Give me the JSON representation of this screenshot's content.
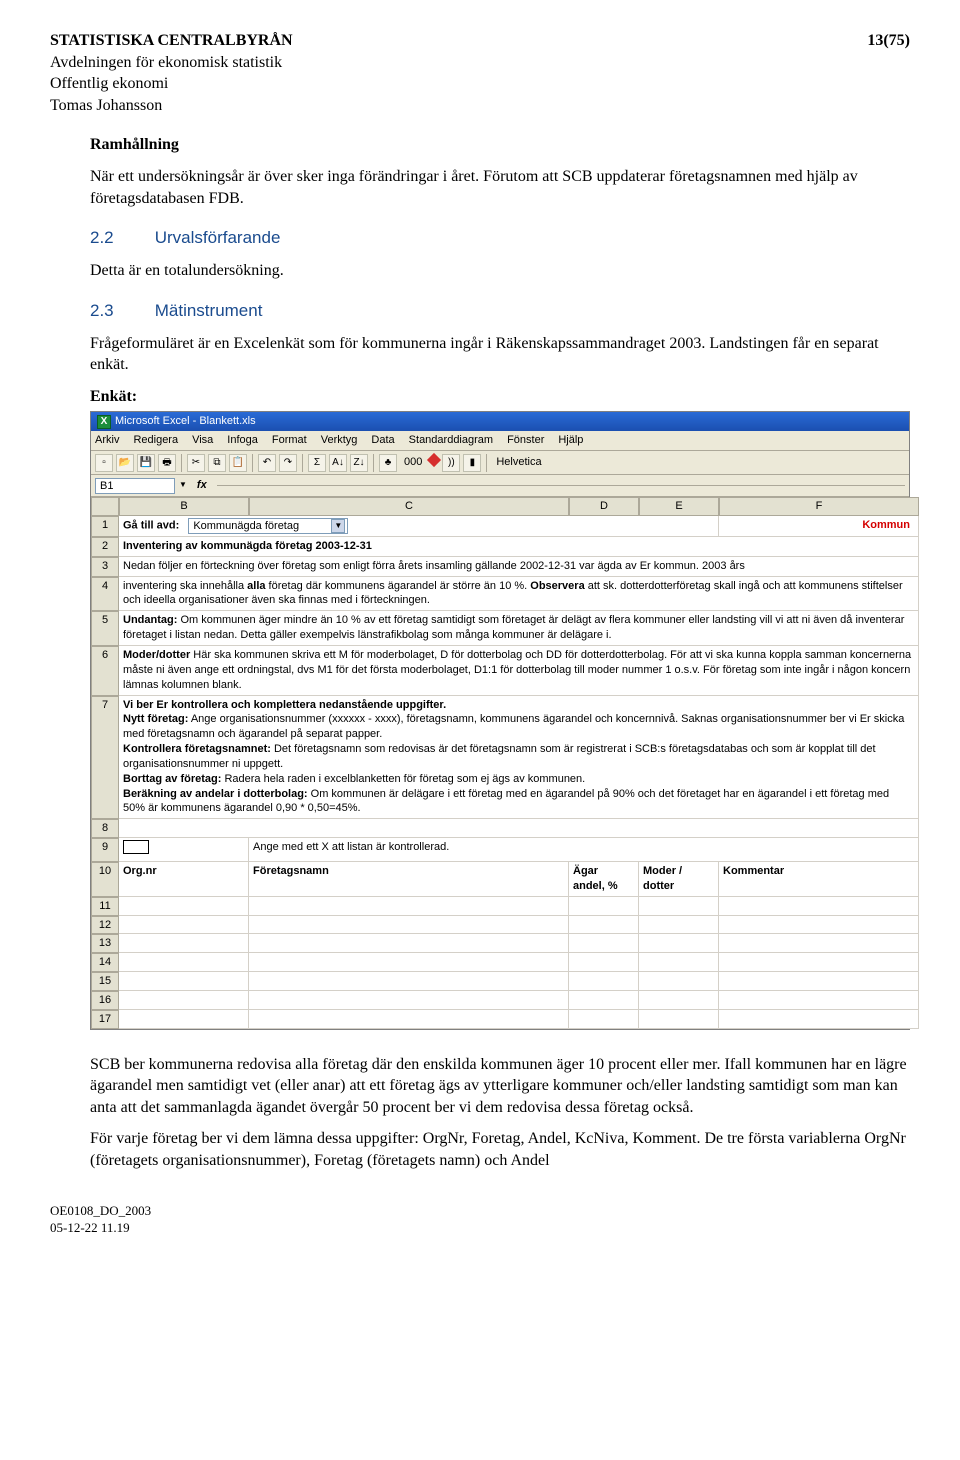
{
  "header": {
    "org": "STATISTISKA CENTRALBYRÅN",
    "page": "13(75)",
    "line2": "Avdelningen för ekonomisk statistik",
    "line3": "Offentlig ekonomi",
    "line4": "Tomas Johansson"
  },
  "body": {
    "ramhallning_title": "Ramhållning",
    "ramhallning_text": "När ett undersökningsår är över sker inga förändringar i året. Förutom att SCB uppdaterar företagsnamnen med hjälp av företagsdatabasen FDB.",
    "s22_num": "2.2",
    "s22_title": "Urvalsförfarande",
    "s22_text": "Detta är en totalundersökning.",
    "s23_num": "2.3",
    "s23_title": "Mätinstrument",
    "s23_text": "Frågeformuläret är en Excelenkät som för kommunerna ingår i Räkenskapssammandraget 2003. Landstingen får en separat enkät.",
    "s23_enkat": "Enkät:",
    "post_excel_p1": "SCB ber kommunerna redovisa alla företag där den enskilda kommunen äger 10 procent eller mer. Ifall kommunen har en lägre ägarandel men samtidigt vet (eller anar) att ett företag ägs av ytterligare kommuner och/eller landsting samtidigt som man kan anta att det sammanlagda ägandet övergår 50 procent ber vi dem redovisa dessa företag också.",
    "post_excel_p2": "För varje företag ber vi dem lämna dessa uppgifter: OrgNr, Foretag, Andel, KcNiva, Komment. De tre första variablerna OrgNr (företagets organisationsnummer), Foretag (företagets namn) och Andel"
  },
  "excel": {
    "title": "Microsoft Excel - Blankett.xls",
    "menu": [
      "Arkiv",
      "Redigera",
      "Visa",
      "Infoga",
      "Format",
      "Verktyg",
      "Data",
      "Standarddiagram",
      "Fönster",
      "Hjälp"
    ],
    "tool_000": "000",
    "tool_font": "Helvetica",
    "namebox": "B1",
    "fx": "fx",
    "cols": [
      "",
      "B",
      "C",
      "D",
      "E",
      "F"
    ],
    "row1_label": "Gå till avd:",
    "row1_dropdown": "Kommunägda företag",
    "row1_right": "Kommun",
    "row2": "Inventering av kommunägda företag 2003-12-31",
    "row3": "Nedan följer en förteckning över företag som enligt förra årets insamling gällande 2002-12-31 var ägda av Er kommun. 2003 års",
    "row4_a": "inventering ska innehålla ",
    "row4_b": "alla",
    "row4_c": " företag där kommunens ägarandel är större än 10 %. ",
    "row4_d": "Observera",
    "row4_e": " att sk. dotterdotterföretag skall ingå och att kommunens stiftelser och ideella organisationer även ska finnas med i förteckningen.",
    "row5_a": "Undantag:",
    "row5_b": " Om kommunen äger mindre än 10 % av ett företag samtidigt som företaget är delägt av flera kommuner eller landsting vill vi att ni även då inventerar företaget i listan nedan. Detta gäller exempelvis länstrafikbolag som många kommuner är delägare i.",
    "row6_a": "Moder/dotter",
    "row6_b": " Här ska kommunen skriva ett M för moderbolaget, D för dotterbolag och DD för dotterdotterbolag. För att vi ska kunna koppla samman koncernerna måste ni även ange ett ordningstal, dvs M1 för det första moderbolaget, D1:1 för dotterbolag till moder nummer 1 o.s.v. För företag som inte ingår i någon koncern lämnas kolumnen blank.",
    "row7_head": "Vi ber Er kontrollera och komplettera nedanstående uppgifter.",
    "row7_nytt_a": "Nytt företag:",
    "row7_nytt_b": " Ange organisationsnummer (xxxxxx - xxxx), företagsnamn, kommunens ägarandel och koncernnivå. Saknas organisationsnummer ber vi Er skicka med företagsnamn och ägarandel på separat papper.",
    "row7_kontr_a": "Kontrollera företagsnamnet:",
    "row7_kontr_b": " Det företagsnamn som redovisas är det företagsnamn som är registrerat i SCB:s företagsdatabas och som är kopplat till det organisationsnummer ni uppgett.",
    "row7_bort_a": "Borttag av företag:",
    "row7_bort_b": " Radera hela raden i excelblanketten för företag som ej ägs av kommunen.",
    "row7_berak_a": "Beräkning av andelar i dotterbolag:",
    "row7_berak_b": " Om kommunen är delägare i ett företag med en ägarandel på 90% och det företaget har en ägarandel i ett företag med 50% är kommunens ägarandel 0,90 * 0,50=45%.",
    "row9_text": "Ange med ett X att listan är kontrollerad.",
    "row10_orgnr": "Org.nr",
    "row10_foretag": "Företagsnamn",
    "row10_agar1": "Ägar",
    "row10_agar2": "andel, %",
    "row10_moder1": "Moder /",
    "row10_moder2": "dotter",
    "row10_komm": "Kommentar"
  },
  "footer1": "OE0108_DO_2003",
  "footer2": "05-12-22 11.19"
}
